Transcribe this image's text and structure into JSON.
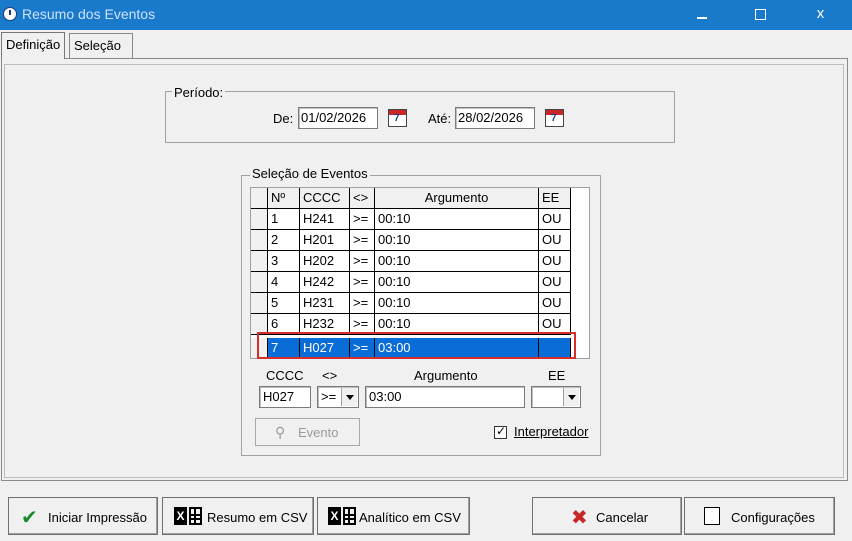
{
  "window": {
    "title": "Resumo dos Eventos",
    "minimize_label": "",
    "maximize_label": "",
    "close_label": "x"
  },
  "tabs": [
    {
      "label": "Definição",
      "active": true
    },
    {
      "label": "Seleção",
      "active": false
    }
  ],
  "periodo": {
    "legend": "Período:",
    "de_label": "De:",
    "de_value": "01/02/2026",
    "ate_label": "Até:",
    "ate_value": "28/02/2026"
  },
  "selecao": {
    "legend": "Seleção de Eventos",
    "columns": [
      "Nº",
      "CCCC",
      "<>",
      "Argumento",
      "EE"
    ],
    "rows": [
      {
        "num": "1",
        "cccc": "H241",
        "op": ">=",
        "arg": "00:10",
        "ee": "OU"
      },
      {
        "num": "2",
        "cccc": "H201",
        "op": ">=",
        "arg": "00:10",
        "ee": "OU"
      },
      {
        "num": "3",
        "cccc": "H202",
        "op": ">=",
        "arg": "00:10",
        "ee": "OU"
      },
      {
        "num": "4",
        "cccc": "H242",
        "op": ">=",
        "arg": "00:10",
        "ee": "OU"
      },
      {
        "num": "5",
        "cccc": "H231",
        "op": ">=",
        "arg": "00:10",
        "ee": "OU"
      },
      {
        "num": "6",
        "cccc": "H232",
        "op": ">=",
        "arg": "00:10",
        "ee": "OU"
      },
      {
        "num": "7",
        "cccc": "H027",
        "op": ">=",
        "arg": "03:00",
        "ee": ""
      }
    ],
    "selected_row": "7"
  },
  "editor": {
    "cccc_label": "CCCC",
    "cccc_value": "H027",
    "op_label": "<>",
    "op_value": ">=",
    "arg_label": "Argumento",
    "arg_value": "03:00",
    "ee_label": "EE",
    "ee_value": "",
    "evento_button": "Evento",
    "interpretador_label": "Interpretador",
    "interpretador_checked": true
  },
  "buttons": {
    "iniciar": "Iniciar Impressão",
    "resumo_csv": "Resumo em CSV",
    "analitico_csv": "Analítico em CSV",
    "cancelar": "Cancelar",
    "configuracoes": "Configurações"
  },
  "colors": {
    "titlebar": "#1979ca",
    "selection": "#0a6cd6",
    "highlight_border": "#d32f2f"
  }
}
